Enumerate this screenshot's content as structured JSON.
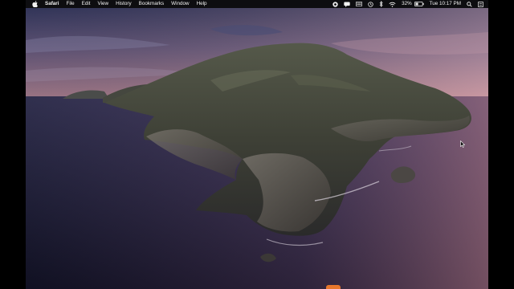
{
  "menubar": {
    "app_name": "Safari",
    "menus": [
      "File",
      "Edit",
      "View",
      "History",
      "Bookmarks",
      "Window",
      "Help"
    ],
    "battery_percent": "32%",
    "clock": "Tue 10:17 PM",
    "status_icons": [
      "record-icon",
      "messages-icon",
      "keyboard-icon",
      "time-machine-icon",
      "bluetooth-icon",
      "wifi-icon",
      "battery-icon",
      "spotlight-icon"
    ]
  },
  "desktop": {
    "wallpaper": "macOS Catalina island at dusk"
  },
  "colors": {
    "menubar_bg": "#0d0d10",
    "dock_peek": "#e8772c"
  }
}
